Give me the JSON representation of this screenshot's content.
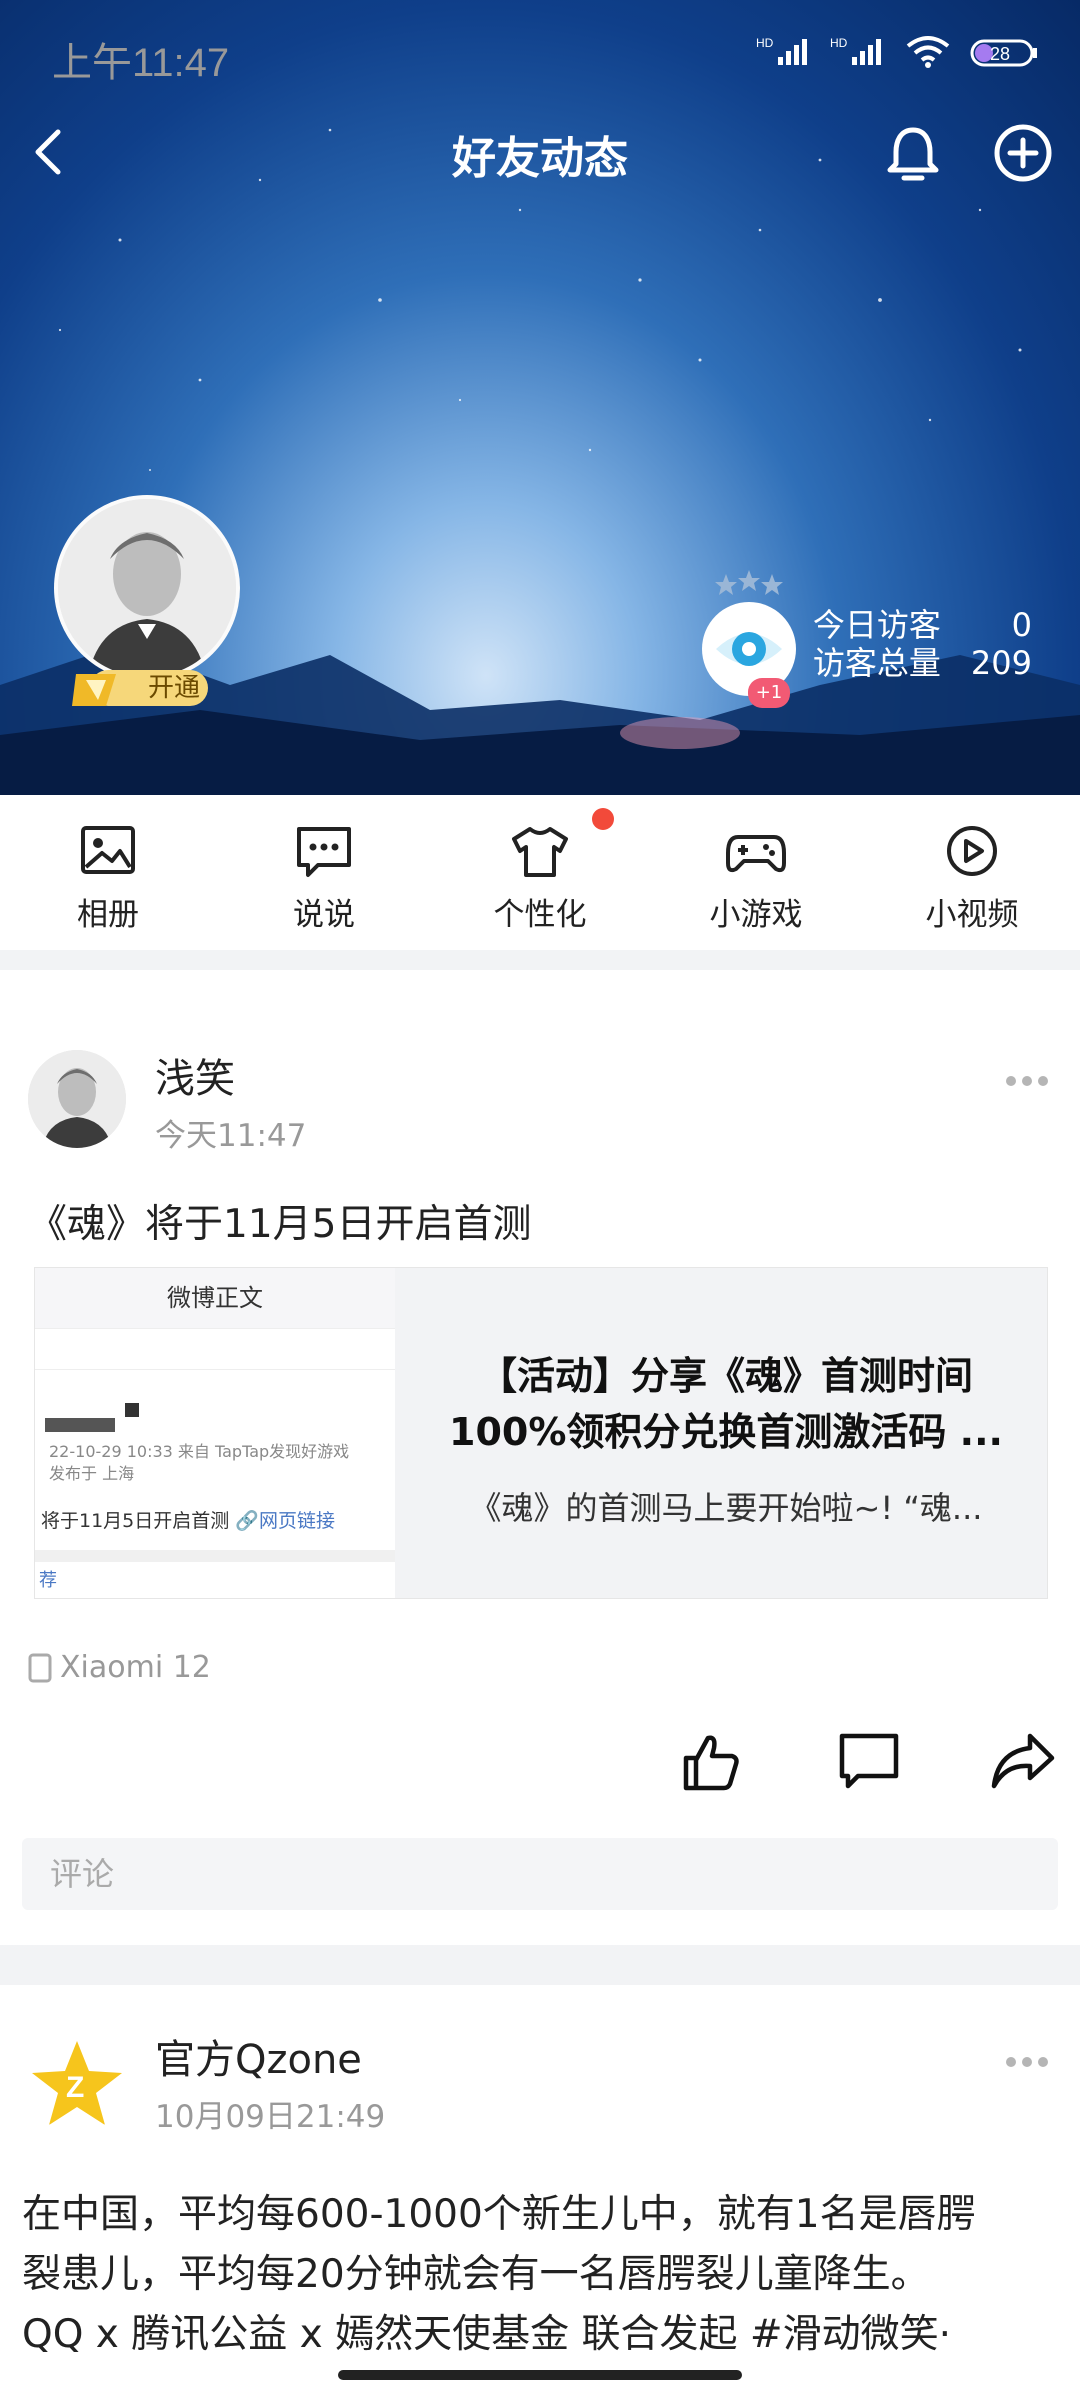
{
  "status_bar": {
    "time": "上午11:47",
    "battery": "28",
    "network_1": "HD",
    "network_2": "HD"
  },
  "header": {
    "title": "好友动态"
  },
  "profile": {
    "vip_label": "开通",
    "visitor_badge": "+1"
  },
  "visitors": {
    "today_label": "今日访客",
    "today_value": "0",
    "total_label": "访客总量",
    "total_value": "209"
  },
  "menu": [
    {
      "label": "相册",
      "icon": "photo-album-icon"
    },
    {
      "label": "说说",
      "icon": "chat-bubble-icon"
    },
    {
      "label": "个性化",
      "icon": "tshirt-icon"
    },
    {
      "label": "小游戏",
      "icon": "gamepad-icon"
    },
    {
      "label": "小视频",
      "icon": "play-circle-icon"
    }
  ],
  "post1": {
    "author": "浅笑",
    "time": "今天11:47",
    "content": "《魂》将于11月5日开启首测",
    "link": {
      "title_line1": "【活动】分享《魂》首测时间",
      "title_line2": "100%领积分兑换首测激活码 ...",
      "desc": "《魂》的首测马上要开始啦~! “魂...",
      "thumb_header": "微博正文",
      "thumb_meta1": "22-10-29 10:33  来自 TapTap发现好游戏",
      "thumb_meta2": "发布于 上海",
      "thumb_text": "将于11月5日开启首测",
      "thumb_link": "网页链接",
      "thumb_recommend": "荐"
    },
    "device": "Xiaomi 12",
    "comment_placeholder": "评论"
  },
  "post2": {
    "author": "官方Qzone",
    "time": "10月09日21:49",
    "line1": "在中国，平均每600-1000个新生儿中，就有1名是唇腭",
    "line2": "裂患儿，平均每20分钟就会有一名唇腭裂儿童降生。",
    "line3": "QQ x 腾讯公益 x 嫣然天使基金 联合发起 #滑动微笑·"
  }
}
